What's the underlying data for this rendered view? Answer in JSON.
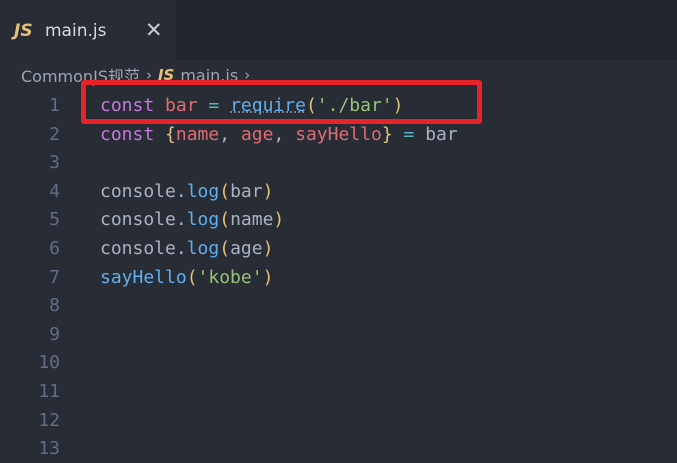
{
  "tab": {
    "icon_text": "JS",
    "label": "main.js",
    "close_glyph": "✕"
  },
  "breadcrumb": {
    "folder": "CommonJS规范",
    "sep1": "›",
    "file_icon": "JS",
    "file": "main.js",
    "sep2": "›"
  },
  "editor": {
    "line_numbers": [
      "1",
      "2",
      "3",
      "4",
      "5",
      "6",
      "7",
      "8",
      "9",
      "10",
      "11",
      "12",
      "13"
    ],
    "lines": [
      [
        {
          "t": "const",
          "c": "kw"
        },
        {
          "t": " ",
          "c": "plain"
        },
        {
          "t": "bar",
          "c": "var"
        },
        {
          "t": " ",
          "c": "plain"
        },
        {
          "t": "=",
          "c": "op"
        },
        {
          "t": " ",
          "c": "plain"
        },
        {
          "t": "require",
          "c": "fn squiggle"
        },
        {
          "t": "(",
          "c": "brk"
        },
        {
          "t": "'./bar'",
          "c": "str"
        },
        {
          "t": ")",
          "c": "brk"
        }
      ],
      [
        {
          "t": "const",
          "c": "kw"
        },
        {
          "t": " ",
          "c": "plain"
        },
        {
          "t": "{",
          "c": "brk"
        },
        {
          "t": "name",
          "c": "prop"
        },
        {
          "t": ", ",
          "c": "plain"
        },
        {
          "t": "age",
          "c": "prop"
        },
        {
          "t": ", ",
          "c": "plain"
        },
        {
          "t": "sayHello",
          "c": "prop"
        },
        {
          "t": "}",
          "c": "brk"
        },
        {
          "t": " ",
          "c": "plain"
        },
        {
          "t": "=",
          "c": "op"
        },
        {
          "t": " ",
          "c": "plain"
        },
        {
          "t": "bar",
          "c": "plain"
        }
      ],
      [],
      [
        {
          "t": "console",
          "c": "obj"
        },
        {
          "t": ".",
          "c": "plain"
        },
        {
          "t": "log",
          "c": "fn"
        },
        {
          "t": "(",
          "c": "brk"
        },
        {
          "t": "bar",
          "c": "plain"
        },
        {
          "t": ")",
          "c": "brk"
        }
      ],
      [
        {
          "t": "console",
          "c": "obj"
        },
        {
          "t": ".",
          "c": "plain"
        },
        {
          "t": "log",
          "c": "fn"
        },
        {
          "t": "(",
          "c": "brk"
        },
        {
          "t": "name",
          "c": "plain"
        },
        {
          "t": ")",
          "c": "brk"
        }
      ],
      [
        {
          "t": "console",
          "c": "obj"
        },
        {
          "t": ".",
          "c": "plain"
        },
        {
          "t": "log",
          "c": "fn"
        },
        {
          "t": "(",
          "c": "brk"
        },
        {
          "t": "age",
          "c": "plain"
        },
        {
          "t": ")",
          "c": "brk"
        }
      ],
      [
        {
          "t": "sayHello",
          "c": "fn"
        },
        {
          "t": "(",
          "c": "brk"
        },
        {
          "t": "'kobe'",
          "c": "str"
        },
        {
          "t": ")",
          "c": "brk"
        }
      ],
      [],
      [],
      [],
      [],
      [],
      []
    ]
  },
  "colors": {
    "editor_bg": "#282c34",
    "tabbar_bg": "#21252b",
    "highlight_border": "#e8232a",
    "keyword": "#c678dd",
    "string": "#98c379",
    "function": "#61afef"
  }
}
